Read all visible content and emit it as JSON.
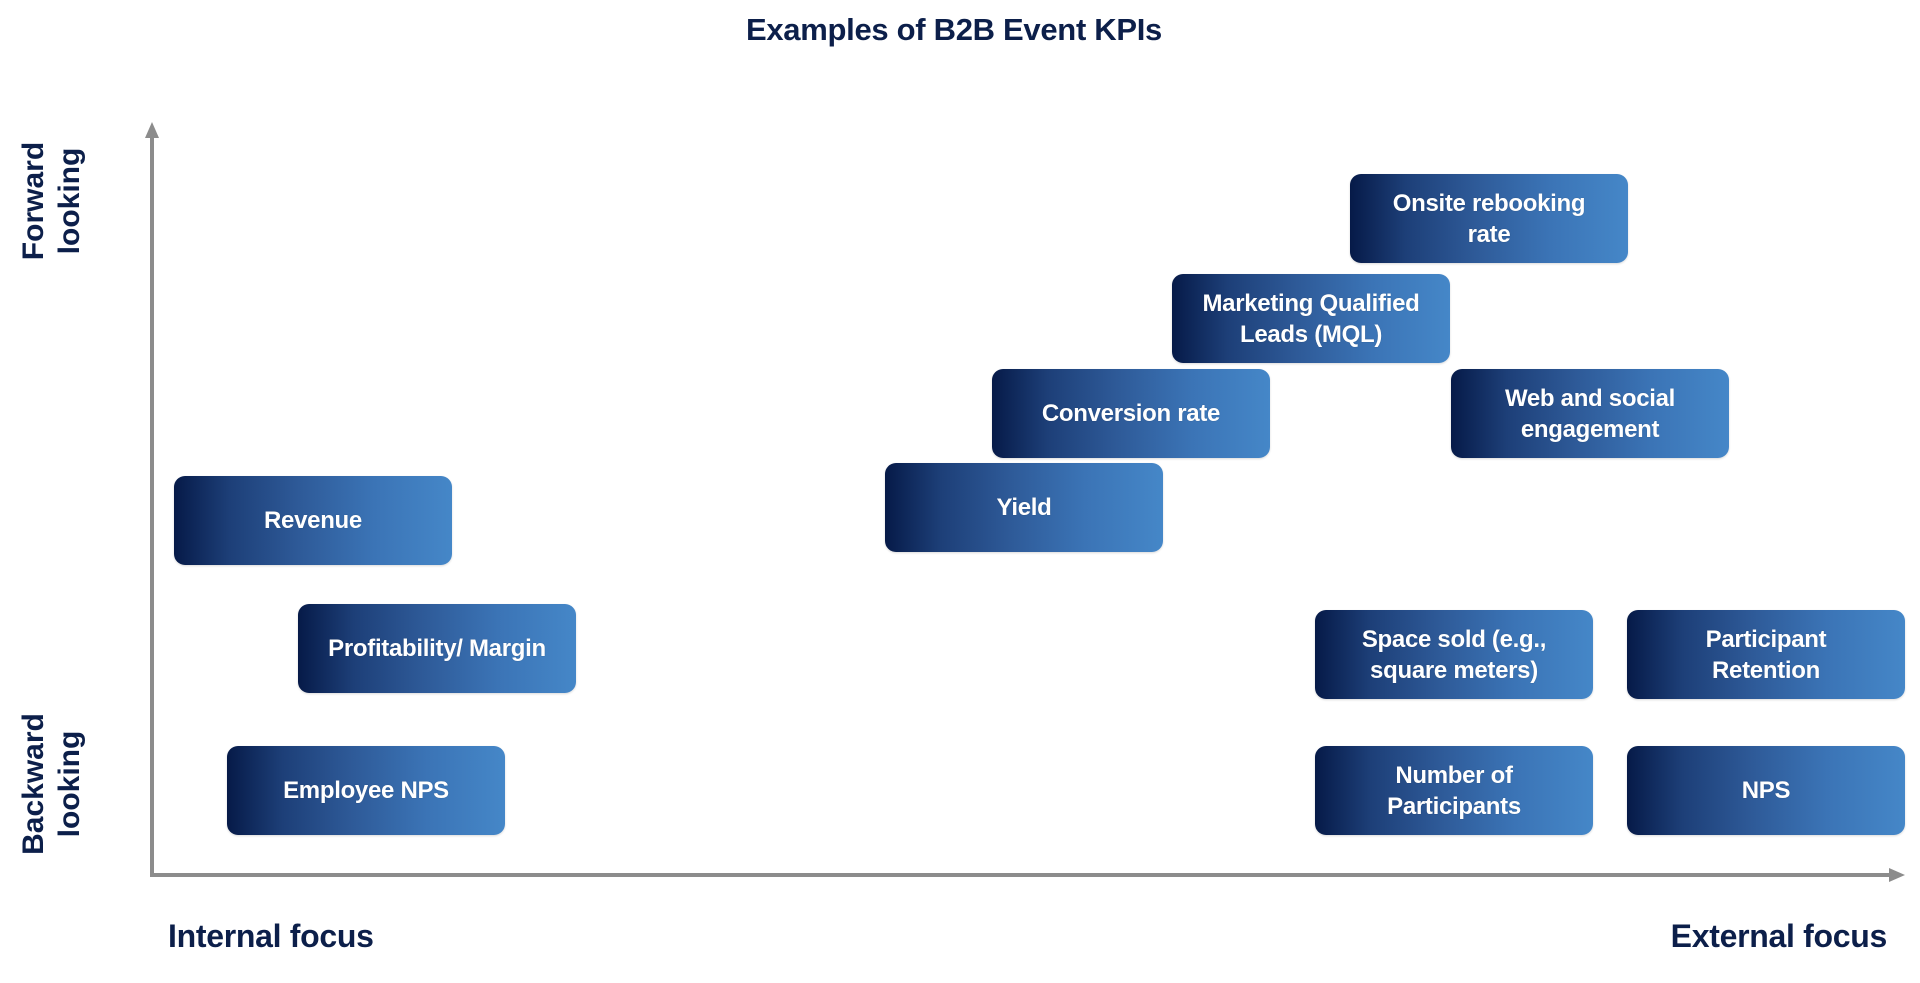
{
  "title": "Examples of B2B Event KPIs",
  "axes": {
    "y_top_label": [
      "Forward",
      "looking"
    ],
    "y_bottom_label": [
      "Backward",
      "looking"
    ],
    "x_left_label": "Internal focus",
    "x_right_label": "External focus",
    "axis_color": "#8c8c8c"
  },
  "colors": {
    "text_navy": "#0c1f4a",
    "box_gradient_start": "#061a48",
    "box_gradient_end": "#4587c8",
    "box_text": "#ffffff"
  },
  "kpis": [
    {
      "id": "onsite-rebooking-rate",
      "label": "Onsite rebooking rate",
      "focus": "external",
      "orientation": "forward"
    },
    {
      "id": "marketing-qualified-leads",
      "label": "Marketing Qualified Leads (MQL)",
      "focus": "external",
      "orientation": "forward"
    },
    {
      "id": "conversion-rate",
      "label": "Conversion rate",
      "focus": "external",
      "orientation": "forward"
    },
    {
      "id": "web-social-engagement",
      "label": "Web and social engagement",
      "focus": "external",
      "orientation": "forward"
    },
    {
      "id": "yield",
      "label": "Yield",
      "focus": "mixed",
      "orientation": "forward"
    },
    {
      "id": "revenue",
      "label": "Revenue",
      "focus": "internal",
      "orientation": "mixed"
    },
    {
      "id": "profitability-margin",
      "label": "Profitability/ Margin",
      "focus": "internal",
      "orientation": "backward"
    },
    {
      "id": "space-sold",
      "label": "Space sold (e.g., square meters)",
      "focus": "external",
      "orientation": "backward"
    },
    {
      "id": "participant-retention",
      "label": "Participant Retention",
      "focus": "external",
      "orientation": "backward"
    },
    {
      "id": "employee-nps",
      "label": "Employee NPS",
      "focus": "internal",
      "orientation": "backward"
    },
    {
      "id": "number-of-participants",
      "label": "Number of Participants",
      "focus": "external",
      "orientation": "backward"
    },
    {
      "id": "nps",
      "label": "NPS",
      "focus": "external",
      "orientation": "backward"
    }
  ]
}
